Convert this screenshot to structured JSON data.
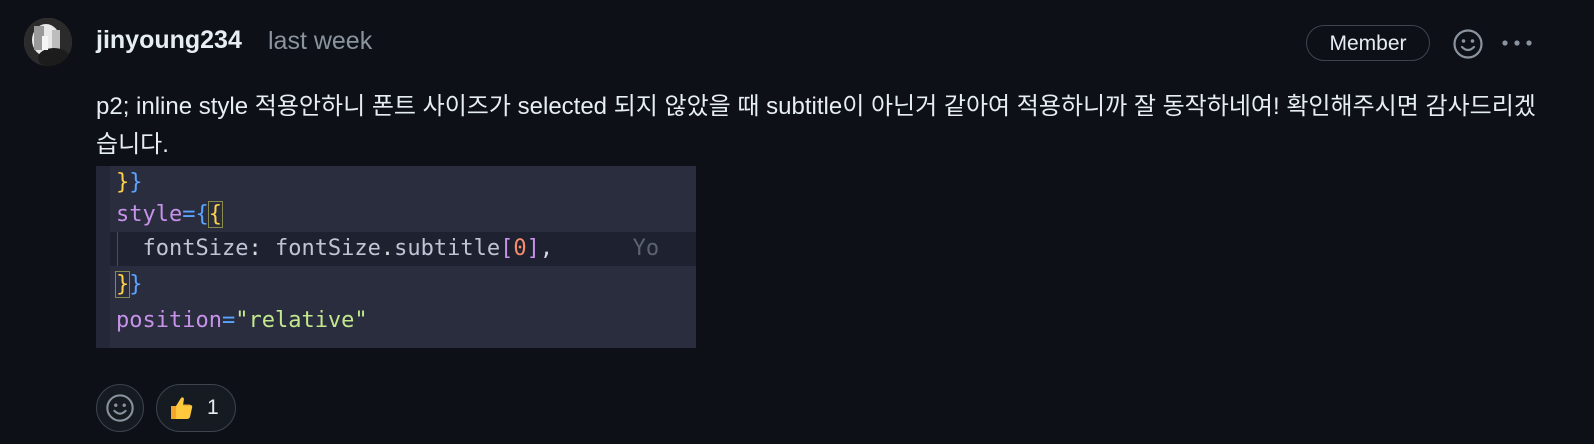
{
  "comment": {
    "author": "jinyoung234",
    "timestamp": "last week",
    "role_badge": "Member",
    "body": "p2; inline style 적용안하니 폰트 사이즈가 selected 되지 않았을 때 subtitle이 아닌거 같아여 적용하니까 잘 동작하네여! 확인해주시면 감사드리겠습니다.",
    "avatar_icon": "avatar-icon",
    "add_reaction_icon": "smiley-icon",
    "more_icon": "kebab-horizontal-icon"
  },
  "code_image": {
    "lines": [
      {
        "segments": [
          {
            "text": "}",
            "color": "yellow"
          },
          {
            "text": "}",
            "color": "blue"
          }
        ]
      },
      {
        "segments": [
          {
            "text": "style",
            "color": "purple"
          },
          {
            "text": "=",
            "color": "blue"
          },
          {
            "text": "{",
            "color": "blue"
          },
          {
            "text": "{",
            "color": "yellow"
          }
        ]
      },
      {
        "segments": [
          {
            "text": "  fontSize",
            "color": "text"
          },
          {
            "text": ": ",
            "color": "white"
          },
          {
            "text": "fontSize",
            "color": "text"
          },
          {
            "text": ".",
            "color": "white"
          },
          {
            "text": "subtitle",
            "color": "text"
          },
          {
            "text": "[",
            "color": "purple"
          },
          {
            "text": "0",
            "color": "orange"
          },
          {
            "text": "]",
            "color": "purple"
          },
          {
            "text": ",",
            "color": "white"
          },
          {
            "text": "      Yo",
            "color": "gray"
          }
        ]
      },
      {
        "segments": [
          {
            "text": "}",
            "color": "yellow"
          },
          {
            "text": "}",
            "color": "blue"
          }
        ]
      },
      {
        "segments": [
          {
            "text": "position",
            "color": "purple"
          },
          {
            "text": "=",
            "color": "blue"
          },
          {
            "text": "\"relative\"",
            "color": "green"
          }
        ]
      }
    ]
  },
  "reactions": [
    {
      "emoji": "thumbs-up-icon",
      "count": "1"
    }
  ],
  "colors": {
    "background": "#0d1117",
    "border": "#3d444d",
    "muted": "#8b949e",
    "code_bg": "#2a2d3e"
  }
}
